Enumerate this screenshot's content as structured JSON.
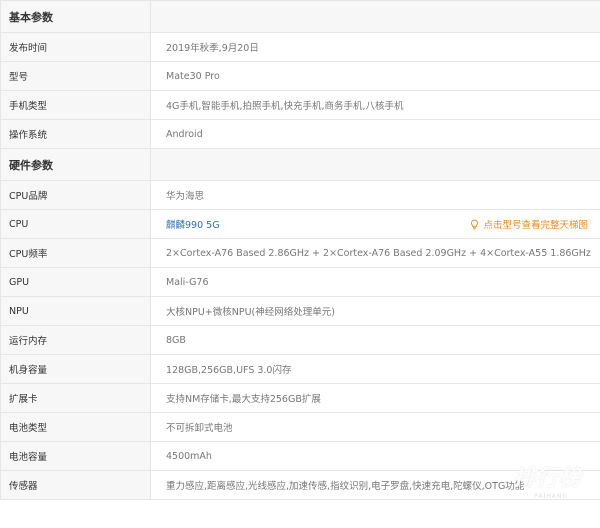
{
  "sections": {
    "basic": "基本参数",
    "hardware": "硬件参数"
  },
  "basic_rows": [
    {
      "label": "发布时间",
      "value": "2019年秋季,9月20日"
    },
    {
      "label": "型号",
      "value": "Mate30 Pro"
    },
    {
      "label": "手机类型",
      "value": "4G手机,智能手机,拍照手机,快充手机,商务手机,八核手机"
    },
    {
      "label": "操作系统",
      "value": "Android"
    }
  ],
  "hardware_rows": [
    {
      "label": "CPU品牌",
      "value": "华为海思"
    },
    {
      "label": "CPU",
      "value": "麒麟990 5G"
    },
    {
      "label": "CPU频率",
      "value": "2×Cortex-A76 Based 2.86GHz + 2×Cortex-A76 Based 2.09GHz + 4×Cortex-A55 1.86GHz"
    },
    {
      "label": "GPU",
      "value": "Mali-G76"
    },
    {
      "label": "NPU",
      "value": "大核NPU+微核NPU(神经网络处理单元)"
    },
    {
      "label": "运行内存",
      "value": "8GB"
    },
    {
      "label": "机身容量",
      "value": "128GB,256GB,UFS 3.0闪存"
    },
    {
      "label": "扩展卡",
      "value": "支持NM存储卡,最大支持256GB扩展"
    },
    {
      "label": "电池类型",
      "value": "不可拆卸式电池"
    },
    {
      "label": "电池容量",
      "value": "4500mAh"
    },
    {
      "label": "传感器",
      "value": "重力感应,距离感应,光线感应,加速传感,指纹识别,电子罗盘,快速充电,陀螺仪,OTG功能"
    }
  ],
  "cpu_hint": "点击型号查看完整天梯图",
  "watermark": {
    "main": "排行榜",
    "sub": "PAIHANG"
  },
  "colors": {
    "link": "#2f6fb7",
    "hint": "#f08a24",
    "label_bg": "#f7f7f7",
    "border": "#e6e6e6"
  }
}
